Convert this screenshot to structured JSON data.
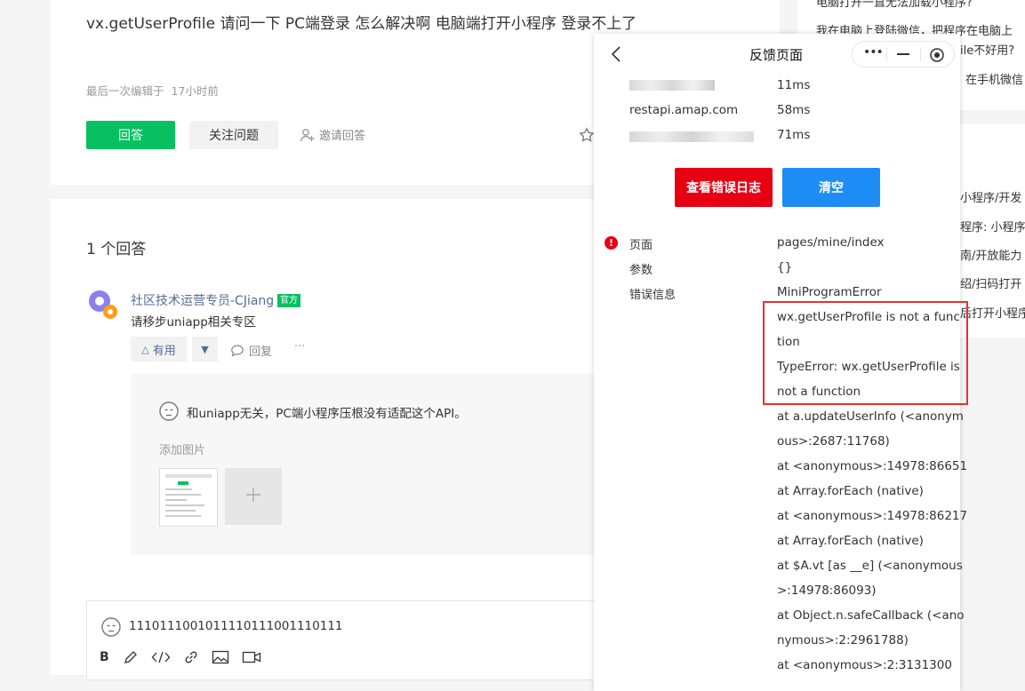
{
  "question": {
    "title": "vx.getUserProfile 请问一下 PC端登录 怎么解决啊 电脑端打开小程序 登录不上了",
    "edited": "最后一次编辑于  17小时前",
    "answer_button": "回答",
    "follow_button": "关注问题",
    "invite_button": "邀请回答"
  },
  "answers": {
    "count_label": "1 个回答",
    "author": "社区技术运营专员-CJiang",
    "badge": "官方",
    "body": "请移步uniapp相关专区",
    "useful": "有用",
    "reply": "回复",
    "more": "···",
    "reply_body": "和uniapp无关，PC端小程序压根没有适配这个API。",
    "add_image": "添加图片",
    "editor_text": "1110111001011110111001110111"
  },
  "right_sidebar": {
    "lines_top": [
      "电脑打开一直无法加载小程序?",
      "我在电脑上登陆微信，把程序在电脑上",
      "ile不好用?",
      "在手机微信"
    ],
    "related": [
      "小程序/开发",
      "程序: 小程序/",
      "南/开放能力",
      "绍/扫码打开",
      "后打开小程序"
    ]
  },
  "popup": {
    "title": "反馈页面",
    "network": [
      {
        "host": "",
        "time": "11ms"
      },
      {
        "host": "restapi.amap.com",
        "time": "58ms"
      },
      {
        "host": "",
        "time": "71ms"
      }
    ],
    "log_button": "查看错误日志",
    "clear_button": "清空",
    "page_label": "页面",
    "page_value": "pages/mine/index",
    "params_label": "参数",
    "params_value": "{}",
    "error_label": "错误信息",
    "error_type": "MiniProgramError",
    "error_lines": [
      "wx.getUserProfile is not a func",
      "tion",
      "TypeError: wx.getUserProfile is",
      "not a function",
      "at a.updateUserInfo (<anonym",
      "ous>:2687:11768)",
      "at <anonymous>:14978:86651",
      "at Array.forEach (native)",
      "at <anonymous>:14978:86217",
      "at Array.forEach (native)",
      "at $A.vt [as __e] (<anonymous",
      ">:14978:86093)",
      "at Object.n.safeCallback (<ano",
      "nymous>:2:2961788)",
      "at <anonymous>:2:3131300"
    ]
  },
  "colors": {
    "green": "#07c160",
    "red": "#e60012",
    "blue": "#1e8cf5"
  }
}
